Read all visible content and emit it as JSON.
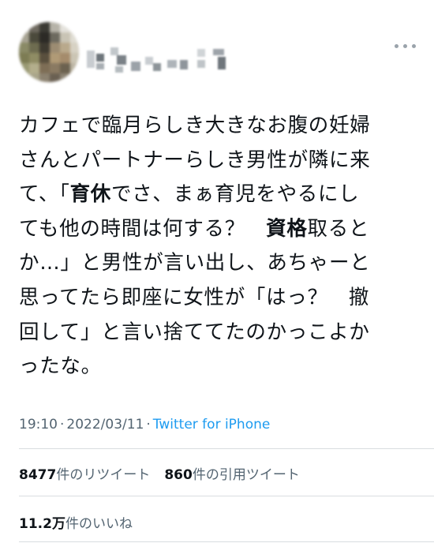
{
  "tweet": {
    "lines": [
      [
        {
          "t": "カフェで臨月らしき大きなお腹の妊婦"
        }
      ],
      [
        {
          "t": "さんとパートナーらしき男性が隣に来"
        }
      ],
      [
        {
          "t": "て、「"
        },
        {
          "t": "育休",
          "b": true
        },
        {
          "t": "でさ、まぁ育児をやるにし"
        }
      ],
      [
        {
          "t": "ても他の時間は何する？　"
        },
        {
          "t": "資格",
          "b": true
        },
        {
          "t": "取ると"
        }
      ],
      [
        {
          "t": "か…」と男性が言い出し、あちゃーと"
        }
      ],
      [
        {
          "t": "思ってたら即座に女性が「はっ？　撤"
        }
      ],
      [
        {
          "t": "回して」と言い捨ててたのかっこよか"
        }
      ],
      [
        {
          "t": "ったな。"
        }
      ]
    ]
  },
  "meta": {
    "time": "19:10",
    "separator": "·",
    "date": "2022/03/11",
    "source": "Twitter for iPhone"
  },
  "stats": {
    "retweet_count": "8477",
    "retweet_label": "件のリツイート",
    "quote_count": "860",
    "quote_label": "件の引用ツイート",
    "like_count": "11.2万",
    "like_label": "件のいいね"
  },
  "icons": {
    "more": "more-horizontal-icon"
  },
  "colors": {
    "text": "#0f1419",
    "secondary": "#536471",
    "link": "#1d9bf0",
    "divider": "#d9dde0"
  }
}
